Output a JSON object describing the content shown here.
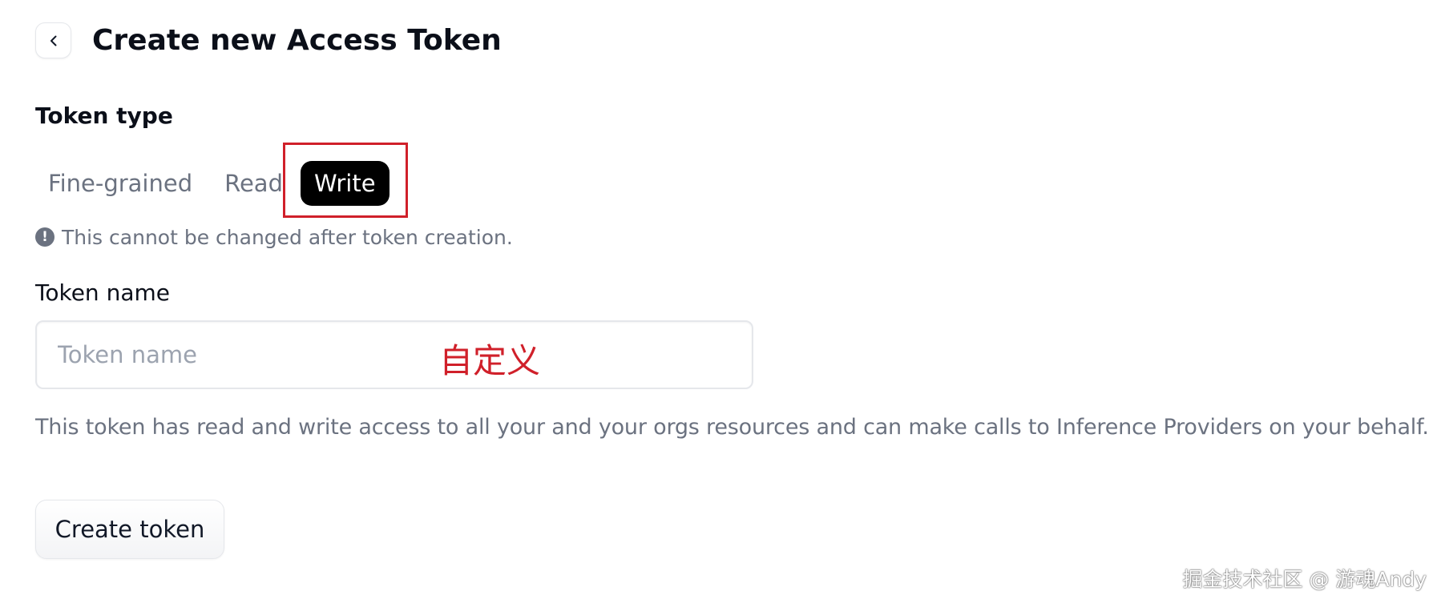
{
  "header": {
    "title": "Create new Access Token",
    "back_icon": "chevron-left-icon"
  },
  "token_type": {
    "label": "Token type",
    "tabs": [
      {
        "label": "Fine-grained",
        "selected": false
      },
      {
        "label": "Read",
        "selected": false
      },
      {
        "label": "Write",
        "selected": true
      }
    ],
    "notice": "This cannot be changed after token creation.",
    "notice_icon": "exclamation-circle-icon"
  },
  "token_name": {
    "label": "Token name",
    "placeholder": "Token name",
    "value": ""
  },
  "annotation": {
    "text": "自定义",
    "color": "#d0202a"
  },
  "description": "This token has read and write access to all your and your orgs resources and can make calls to Inference Providers on your behalf.",
  "actions": {
    "create_label": "Create token"
  },
  "watermark": "掘金技术社区 @ 游魂Andy",
  "colors": {
    "active_tab_bg": "#000000",
    "highlight": "#d0202a",
    "muted_text": "#6b7280"
  }
}
